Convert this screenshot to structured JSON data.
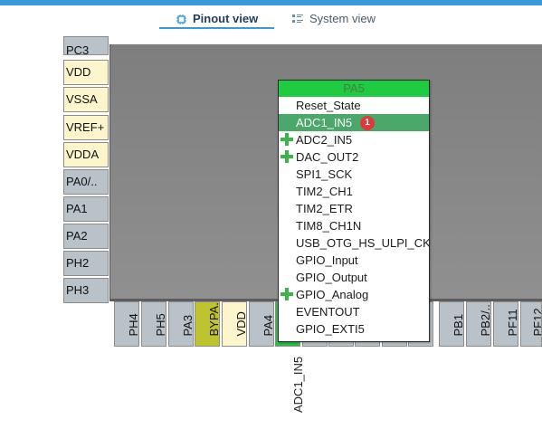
{
  "tabs": {
    "pinout": "Pinout view",
    "system": "System view"
  },
  "left_pins": [
    "PC3",
    "VDD",
    "VSSA",
    "VREF+",
    "VDDA",
    "PA0/..",
    "PA1",
    "PA2",
    "PH2",
    "PH3"
  ],
  "bottom_pins_left": [
    "PH4",
    "PH5",
    "PA3",
    "BYPA..",
    "VDD",
    "PA4",
    "P"
  ],
  "bottom_pins_right": [
    "PB1",
    "PB2/..",
    "PF11",
    "PF12"
  ],
  "signal_label": "ADC1_IN5",
  "menu": {
    "title": "PA5",
    "badge": "1",
    "items": [
      {
        "label": "Reset_State"
      },
      {
        "label": "ADC1_IN5"
      },
      {
        "label": "ADC2_IN5"
      },
      {
        "label": "DAC_OUT2"
      },
      {
        "label": "SPI1_SCK"
      },
      {
        "label": "TIM2_CH1"
      },
      {
        "label": "TIM2_ETR"
      },
      {
        "label": "TIM8_CH1N"
      },
      {
        "label": "USB_OTG_HS_ULPI_CK"
      },
      {
        "label": "GPIO_Input"
      },
      {
        "label": "GPIO_Output"
      },
      {
        "label": "GPIO_Analog"
      },
      {
        "label": "EVENTOUT"
      },
      {
        "label": "GPIO_EXTI5"
      }
    ]
  },
  "colors": {
    "accent": "#3a9ad9",
    "pin_gray": "#b8c2c8",
    "pin_power": "#fdf5cc",
    "pin_assigned": "#2dbd4a",
    "menu_selected": "#4aa86b"
  }
}
